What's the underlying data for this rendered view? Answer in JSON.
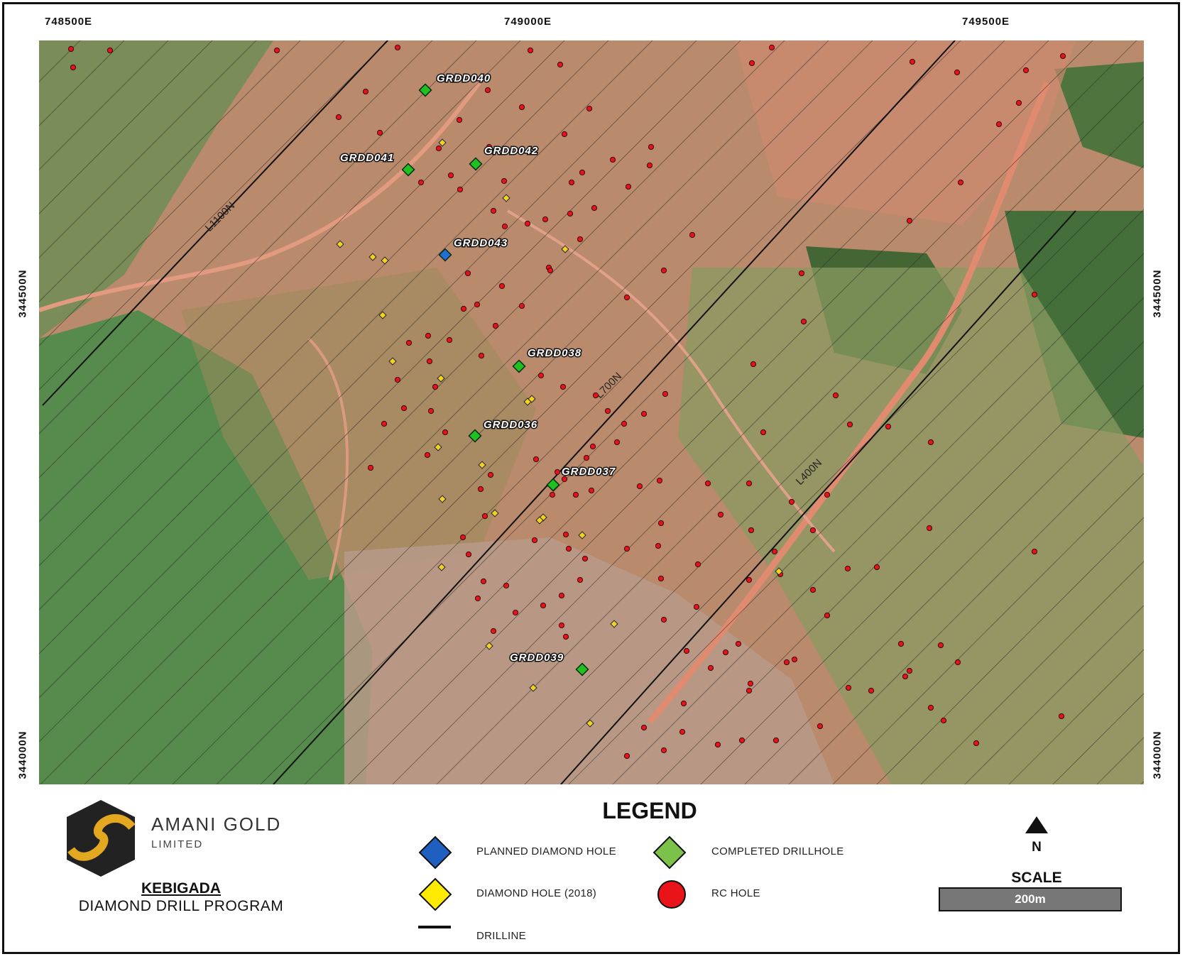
{
  "coordinates": {
    "east": [
      "748500E",
      "749000E",
      "749500E"
    ],
    "north": [
      "344500N",
      "344000N"
    ]
  },
  "drill_lines": [
    "L1100N",
    "L700N",
    "L400N"
  ],
  "holes": [
    {
      "id": "GRDD040",
      "status": "completed"
    },
    {
      "id": "GRDD041",
      "status": "completed"
    },
    {
      "id": "GRDD042",
      "status": "completed"
    },
    {
      "id": "GRDD043",
      "status": "planned"
    },
    {
      "id": "GRDD038",
      "status": "completed"
    },
    {
      "id": "GRDD036",
      "status": "completed"
    },
    {
      "id": "GRDD037",
      "status": "completed"
    },
    {
      "id": "GRDD039",
      "status": "completed"
    }
  ],
  "legend": {
    "title": "LEGEND",
    "items": [
      {
        "label": "PLANNED DIAMOND HOLE",
        "color": "#1f5fbf"
      },
      {
        "label": "COMPLETED DRILLHOLE",
        "color": "#7cc24a"
      },
      {
        "label": "DIAMOND HOLE (2018)",
        "color": "#ffeb00"
      },
      {
        "label": "RC HOLE",
        "color": "#e8141a"
      },
      {
        "label": "DRILLINE",
        "color": "#111111"
      }
    ]
  },
  "company": {
    "name": "AMANI GOLD",
    "sub": "LIMITED",
    "accent": "#e3a81f"
  },
  "project": {
    "title": "KEBIGADA",
    "subtitle": "DIAMOND DRILL PROGRAM"
  },
  "north": "N",
  "scale": {
    "title": "SCALE",
    "label": "200m"
  },
  "colors": {
    "completed": "#1ec21e",
    "planned": "#1f6fd6",
    "diamond2018": "#f2d21a",
    "rc": "#e3141a"
  }
}
